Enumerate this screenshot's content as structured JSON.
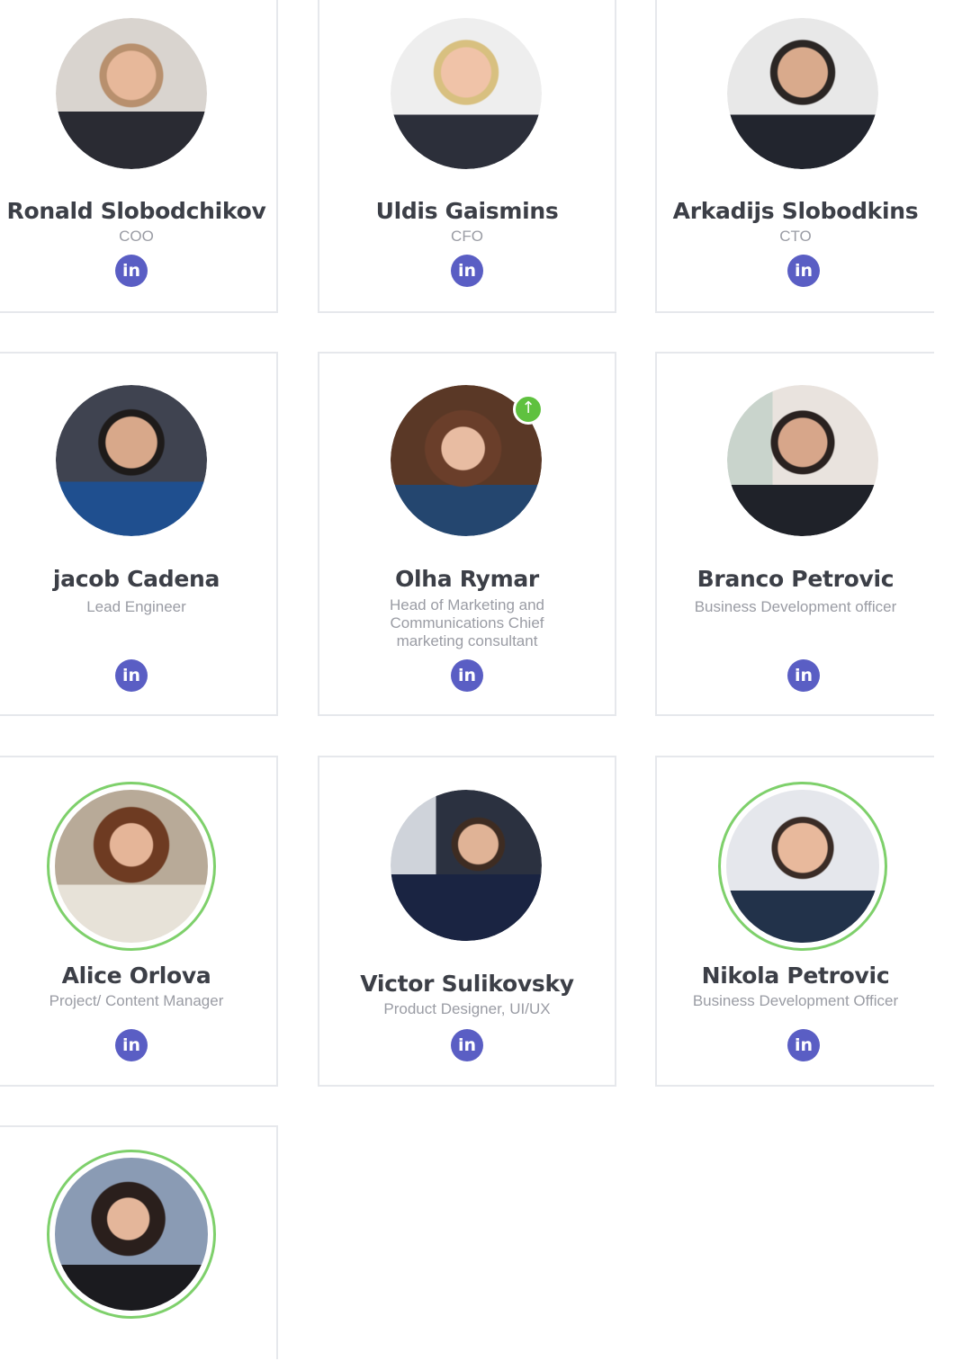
{
  "team": [
    {
      "name": "Ronald Slobodchikov",
      "role": "COO",
      "linkedin_icon": "linkedin-icon"
    },
    {
      "name": "Uldis Gaismins",
      "role": "CFO",
      "linkedin_icon": "linkedin-icon"
    },
    {
      "name": "Arkadijs Slobodkins",
      "role": "CTO",
      "linkedin_icon": "linkedin-icon"
    },
    {
      "name": "jacob Cadena",
      "role": "Lead Engineer",
      "linkedin_icon": "linkedin-icon"
    },
    {
      "name": "Olha Rymar",
      "role": "Head of Marketing and Communications Chief marketing consultant",
      "linkedin_icon": "linkedin-icon",
      "badge_icon": "arrow-up-icon"
    },
    {
      "name": "Branco Petrovic",
      "role": "Business Development officer",
      "linkedin_icon": "linkedin-icon"
    },
    {
      "name": "Alice Orlova",
      "role": "Project/ Content Manager",
      "linkedin_icon": "linkedin-icon"
    },
    {
      "name": "Victor Sulikovsky",
      "role": "Product Designer, UI/UX",
      "linkedin_icon": "linkedin-icon"
    },
    {
      "name": "Nikola Petrovic",
      "role": "Business Development Officer",
      "linkedin_icon": "linkedin-icon"
    }
  ],
  "linkedin_label": "in",
  "badge_glyph": "↑",
  "colors": {
    "linkedin": "#5a5ec4",
    "ring": "#7ed06b",
    "badge": "#5fc13f",
    "name": "#3c3f47",
    "role": "#9a9ca4",
    "card_border": "#e6e8ec"
  }
}
